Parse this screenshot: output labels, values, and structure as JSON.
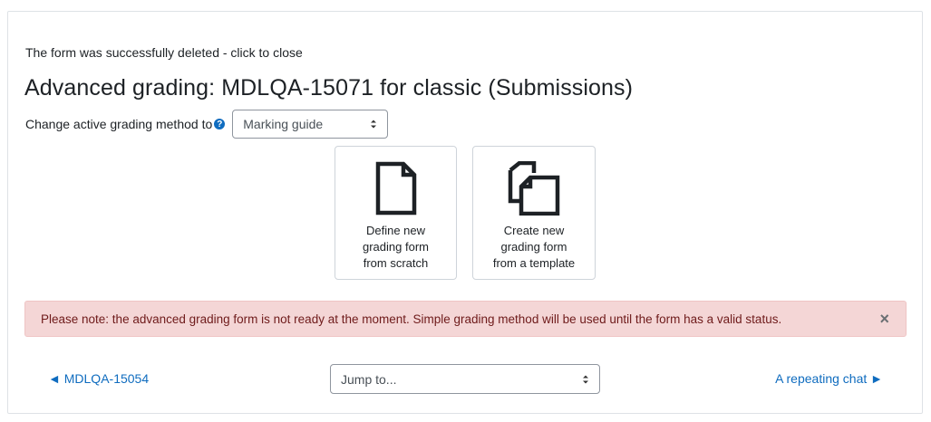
{
  "notice": {
    "text": "The form was successfully deleted - click to close"
  },
  "page": {
    "title": "Advanced grading: MDLQA-15071 for classic (Submissions)"
  },
  "method": {
    "label": "Change active grading method to",
    "help_icon": "question-circle-icon",
    "selected": "Marking guide"
  },
  "actions": [
    {
      "label": "Define new\ngrading form\nfrom scratch",
      "icon": "document-icon"
    },
    {
      "label": "Create new\ngrading form\nfrom a template",
      "icon": "copy-documents-icon"
    }
  ],
  "alert": {
    "text": "Please note: the advanced grading form is not ready at the moment. Simple grading method will be used until the form has a valid status.",
    "close": "×",
    "background": "#f4d6d6",
    "color": "#6e1a1a"
  },
  "navigation": {
    "prev": "◄ MDLQA-15054",
    "jump_placeholder": "Jump to...",
    "next": "A repeating chat ►",
    "link_color": "#0f6cbf"
  }
}
